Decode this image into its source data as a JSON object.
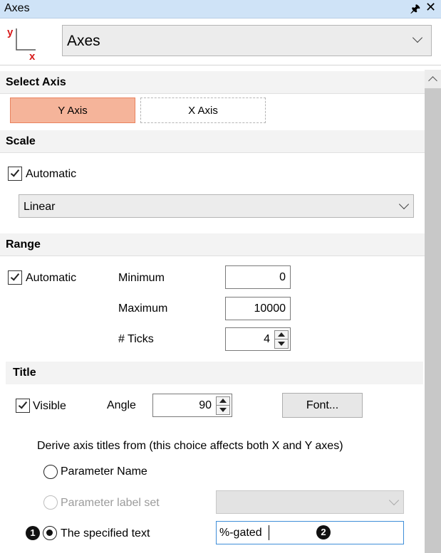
{
  "window": {
    "title": "Axes",
    "pin_icon": "pin-icon",
    "close_icon": "close-icon"
  },
  "header": {
    "logo": {
      "y": "y",
      "x": "x"
    },
    "panel_select": "Axes"
  },
  "select_axis": {
    "heading": "Select Axis",
    "y_axis": "Y Axis",
    "x_axis": "X Axis",
    "selected": "Y Axis",
    "selected_color": "#f5b49a"
  },
  "scale": {
    "heading": "Scale",
    "automatic_label": "Automatic",
    "automatic_checked": true,
    "type": "Linear"
  },
  "range": {
    "heading": "Range",
    "automatic_label": "Automatic",
    "automatic_checked": true,
    "minimum_label": "Minimum",
    "minimum": "0",
    "maximum_label": "Maximum",
    "maximum": "10000",
    "ticks_label": "# Ticks",
    "ticks": "4"
  },
  "title": {
    "heading": "Title",
    "visible_label": "Visible",
    "visible_checked": true,
    "angle_label": "Angle",
    "angle": "90",
    "font_button": "Font...",
    "derive_label": "Derive axis titles from (this choice affects both X and Y axes)",
    "options": {
      "parameter_name": "Parameter Name",
      "parameter_label_set": "Parameter label set",
      "specified_text": "The specified text"
    },
    "selected_option": "The specified text",
    "specified_value": "%-gated",
    "callouts": {
      "one": "1",
      "two": "2"
    }
  }
}
